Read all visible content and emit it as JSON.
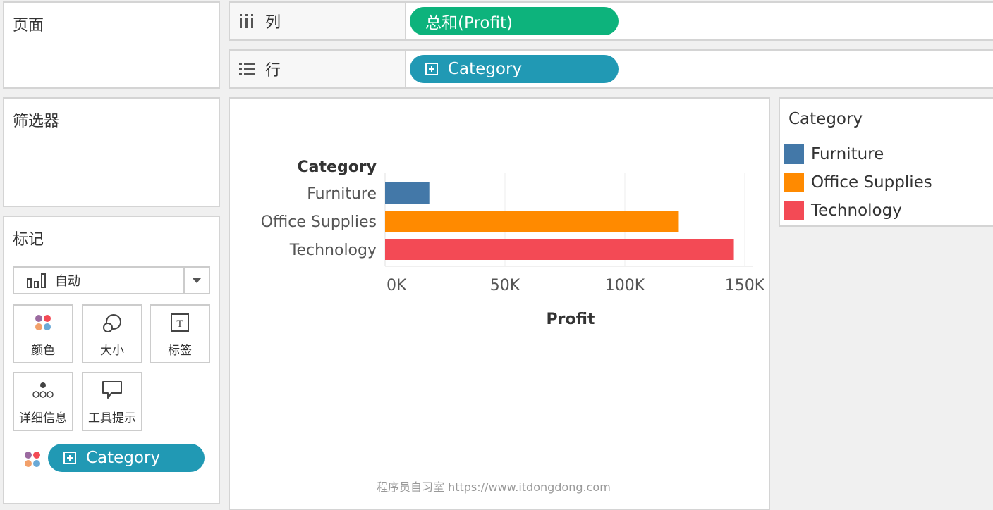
{
  "pages_panel": {
    "title": "页面"
  },
  "filters_panel": {
    "title": "筛选器"
  },
  "marks_panel": {
    "title": "标记",
    "mark_type": "自动",
    "buttons": [
      {
        "label": "颜色",
        "icon": "color-icon"
      },
      {
        "label": "大小",
        "icon": "size-icon"
      },
      {
        "label": "标签",
        "icon": "label-icon"
      },
      {
        "label": "详细信息",
        "icon": "detail-icon"
      },
      {
        "label": "工具提示",
        "icon": "tooltip-icon"
      }
    ],
    "color_pill": "Category"
  },
  "columns_shelf": {
    "label": "列",
    "pill": "总和(Profit)"
  },
  "rows_shelf": {
    "label": "行",
    "pill": "Category"
  },
  "legend": {
    "title": "Category",
    "items": [
      {
        "label": "Furniture",
        "color": "#4378a8"
      },
      {
        "label": "Office Supplies",
        "color": "#ff8a00"
      },
      {
        "label": "Technology",
        "color": "#f34a55"
      }
    ]
  },
  "chart_data": {
    "type": "bar",
    "orientation": "horizontal",
    "row_header": "Category",
    "categories": [
      "Furniture",
      "Office Supplies",
      "Technology"
    ],
    "values": [
      18451,
      122491,
      145455
    ],
    "colors": [
      "#4378a8",
      "#ff8a00",
      "#f34a55"
    ],
    "xlabel": "Profit",
    "xlim": [
      0,
      150000
    ],
    "xticks": [
      0,
      50000,
      100000,
      150000
    ],
    "xtick_labels": [
      "0K",
      "50K",
      "100K",
      "150K"
    ],
    "grid": true
  },
  "watermark": "程序员自习室 https://www.itdongdong.com"
}
